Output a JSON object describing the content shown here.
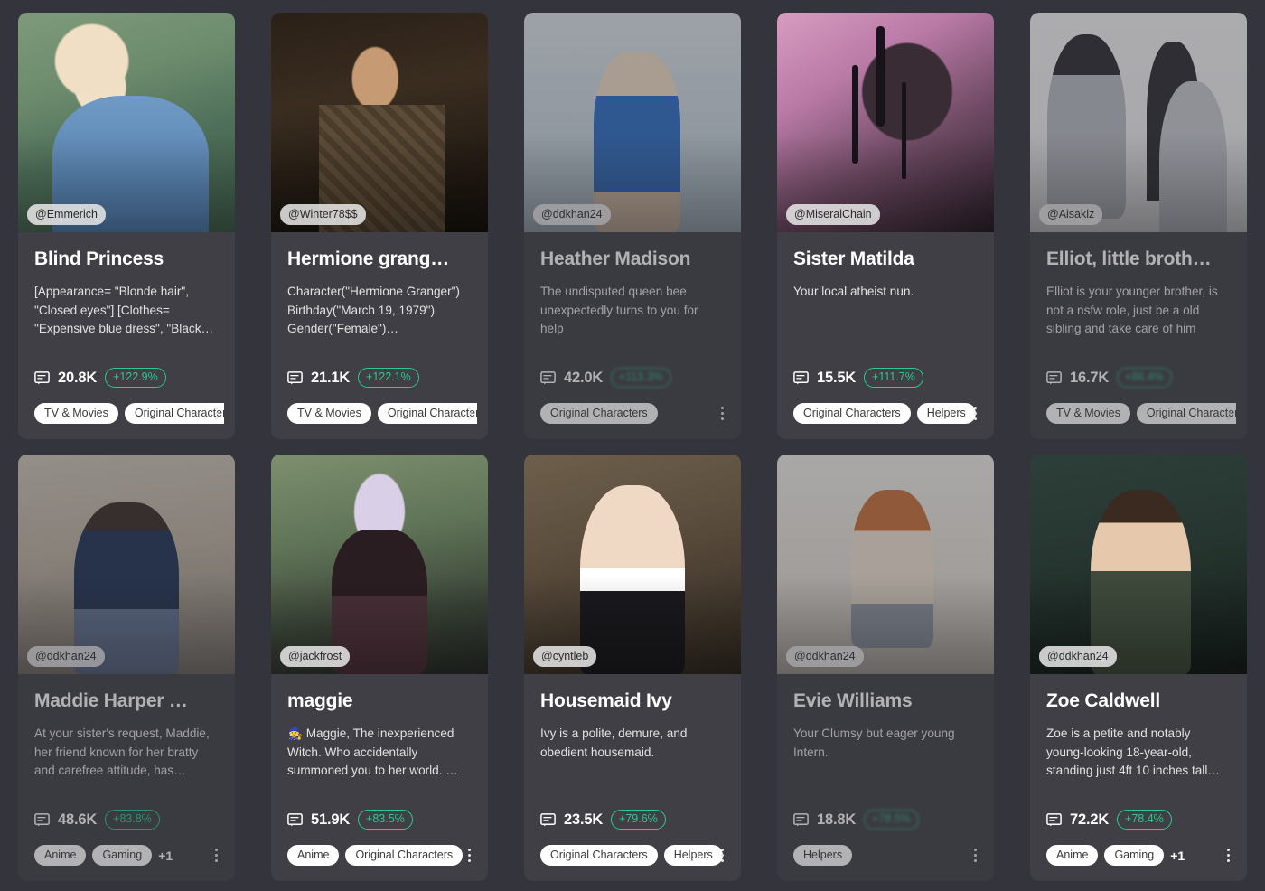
{
  "theme": {
    "page_background": "#34343c",
    "card_background": "#3f3f45",
    "accent_trend": "#2ec98b",
    "tag_background": "#ffffff",
    "title_color": "#ffffff"
  },
  "icons": {
    "chat": "chat-bubble-icon",
    "kebab": "more-options-icon"
  },
  "cards": [
    {
      "user": "@Emmerich",
      "title": "Blind Princess",
      "description": "[Appearance= \"Blonde hair\", \"Closed eyes\"] [Clothes= \"Expensive blue dress\", \"Black…",
      "count": "20.8K",
      "trend": "+122.9%",
      "trend_blurred": false,
      "tags": [
        "TV & Movies",
        "Original Characters"
      ],
      "extra_tags": "",
      "art": "art-blind",
      "dim": ""
    },
    {
      "user": "@Winter78$$",
      "title": "Hermione grang…",
      "description": "Character(\"Hermione Granger\") Birthday(\"March 19, 1979\") Gender(\"Female\")…",
      "count": "21.1K",
      "trend": "+122.1%",
      "trend_blurred": false,
      "tags": [
        "TV & Movies",
        "Original Characters"
      ],
      "extra_tags": "",
      "art": "art-hermione",
      "dim": ""
    },
    {
      "user": "@ddkhan24",
      "title": "Heather Madison",
      "description": "The undisputed queen bee unexpectedly turns to you for help",
      "count": "42.0K",
      "trend": "+113.3%",
      "trend_blurred": true,
      "tags": [
        "Original Characters"
      ],
      "extra_tags": "",
      "art": "art-heather",
      "dim": "dim"
    },
    {
      "user": "@MiseralChain",
      "title": "Sister Matilda",
      "description": "Your local atheist nun.",
      "count": "15.5K",
      "trend": "+111.7%",
      "trend_blurred": false,
      "tags": [
        "Original Characters",
        "Helpers"
      ],
      "extra_tags": "",
      "art": "art-matilda",
      "dim": ""
    },
    {
      "user": "@Aisaklz",
      "title": "Elliot, little broth…",
      "description": "Elliot is your younger brother, is not a nsfw role, just be a old sibling and take care of him",
      "count": "16.7K",
      "trend": "+86.4%",
      "trend_blurred": true,
      "tags": [
        "TV & Movies",
        "Original Characters"
      ],
      "extra_tags": "",
      "art": "art-elliot",
      "dim": "dim"
    },
    {
      "user": "@ddkhan24",
      "title": "Maddie Harper …",
      "description": "At your sister's request, Maddie, her friend known for her bratty and carefree attitude, has…",
      "count": "48.6K",
      "trend": "+83.8%",
      "trend_blurred": false,
      "tags": [
        "Anime",
        "Gaming"
      ],
      "extra_tags": "+1",
      "art": "art-maddie",
      "dim": "dim"
    },
    {
      "user": "@jackfrost",
      "title": "maggie",
      "description": "🧙 Maggie, The inexperienced Witch. Who accidentally summoned you to her world. …",
      "count": "51.9K",
      "trend": "+83.5%",
      "trend_blurred": false,
      "tags": [
        "Anime",
        "Original Characters"
      ],
      "extra_tags": "",
      "art": "art-maggie",
      "dim": ""
    },
    {
      "user": "@cyntleb",
      "title": "Housemaid Ivy",
      "description": "Ivy is a polite, demure, and obedient housemaid.",
      "count": "23.5K",
      "trend": "+79.6%",
      "trend_blurred": false,
      "tags": [
        "Original Characters",
        "Helpers"
      ],
      "extra_tags": "",
      "art": "art-ivy",
      "dim": ""
    },
    {
      "user": "@ddkhan24",
      "title": "Evie Williams",
      "description": "Your Clumsy but eager young Intern.",
      "count": "18.8K",
      "trend": "+78.5%",
      "trend_blurred": true,
      "tags": [
        "Helpers"
      ],
      "extra_tags": "",
      "art": "art-evie",
      "dim": "dim"
    },
    {
      "user": "@ddkhan24",
      "title": "Zoe Caldwell",
      "description": "Zoe is a petite and notably young-looking 18-year-old, standing just 4ft 10 inches tall…",
      "count": "72.2K",
      "trend": "+78.4%",
      "trend_blurred": false,
      "tags": [
        "Anime",
        "Gaming"
      ],
      "extra_tags": "+1",
      "art": "art-zoe",
      "dim": ""
    }
  ]
}
